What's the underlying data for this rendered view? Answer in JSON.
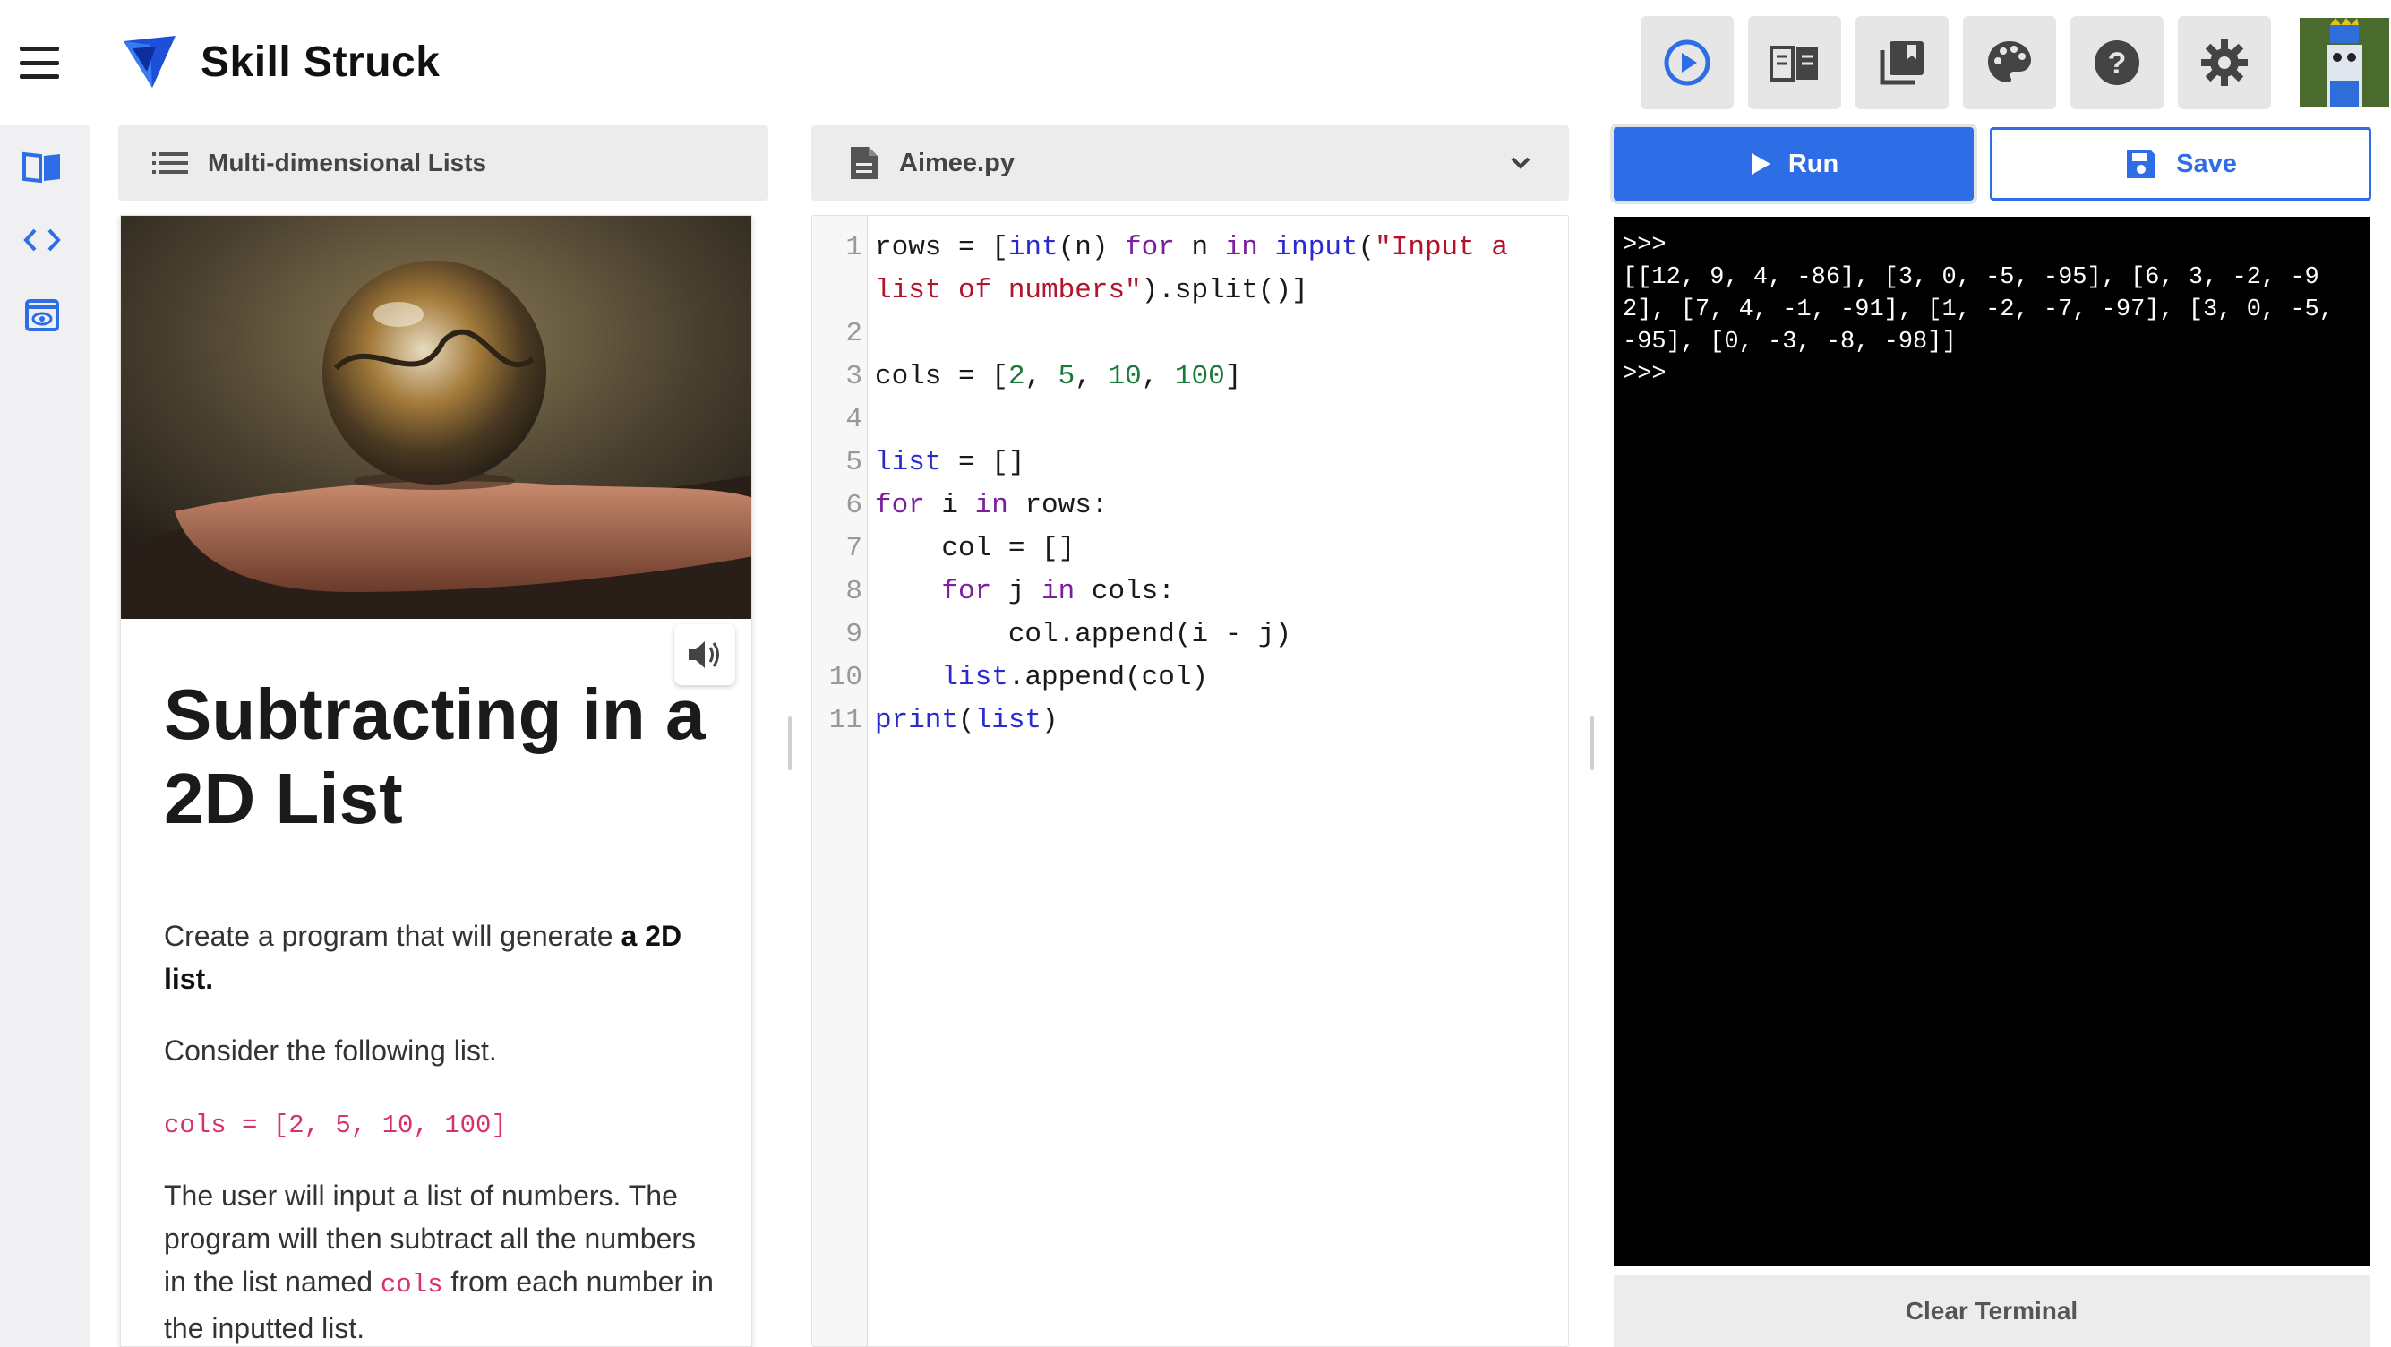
{
  "app": {
    "brand": "Skill Struck"
  },
  "toolbar": {
    "icons": [
      "play-circle-icon",
      "book-open-icon",
      "library-icon",
      "palette-icon",
      "help-icon",
      "gear-icon"
    ]
  },
  "sidebar": {
    "icons": [
      "book-icon",
      "code-icon",
      "preview-icon"
    ]
  },
  "lesson": {
    "module_title": "Multi-dimensional Lists",
    "title": "Subtracting in a 2D List",
    "p1_text": "Create a program that will generate ",
    "p1_bold": "a 2D list.",
    "p2": "Consider the following list.",
    "code_example": "cols = [2, 5, 10, 100]",
    "p3_a": "The user will input a list of numbers. The program will then subtract all the numbers in the list named ",
    "p3_code": "cols",
    "p3_b": " from each number in the inputted list."
  },
  "editor": {
    "filename": "Aimee.py",
    "line_numbers": [
      "1",
      "",
      "2",
      "3",
      "4",
      "5",
      "6",
      "7",
      "8",
      "9",
      "10",
      "11"
    ]
  },
  "actions": {
    "run_label": "Run",
    "save_label": "Save",
    "clear_label": "Clear Terminal"
  },
  "terminal": {
    "output": ">>>\n[[12, 9, 4, -86], [3, 0, -5, -95], [6, 3, -2, -92], [7, 4, -1, -91], [1, -2, -7, -97], [3, 0, -5, -95], [0, -3, -8, -98]]\n>>>"
  },
  "colors": {
    "accent": "#2d6ee6",
    "keyword": "#7a1f9e",
    "builtin": "#2a2ad0",
    "string": "#b3132b",
    "number": "#1a7a3a",
    "inline_code": "#d6336c"
  }
}
